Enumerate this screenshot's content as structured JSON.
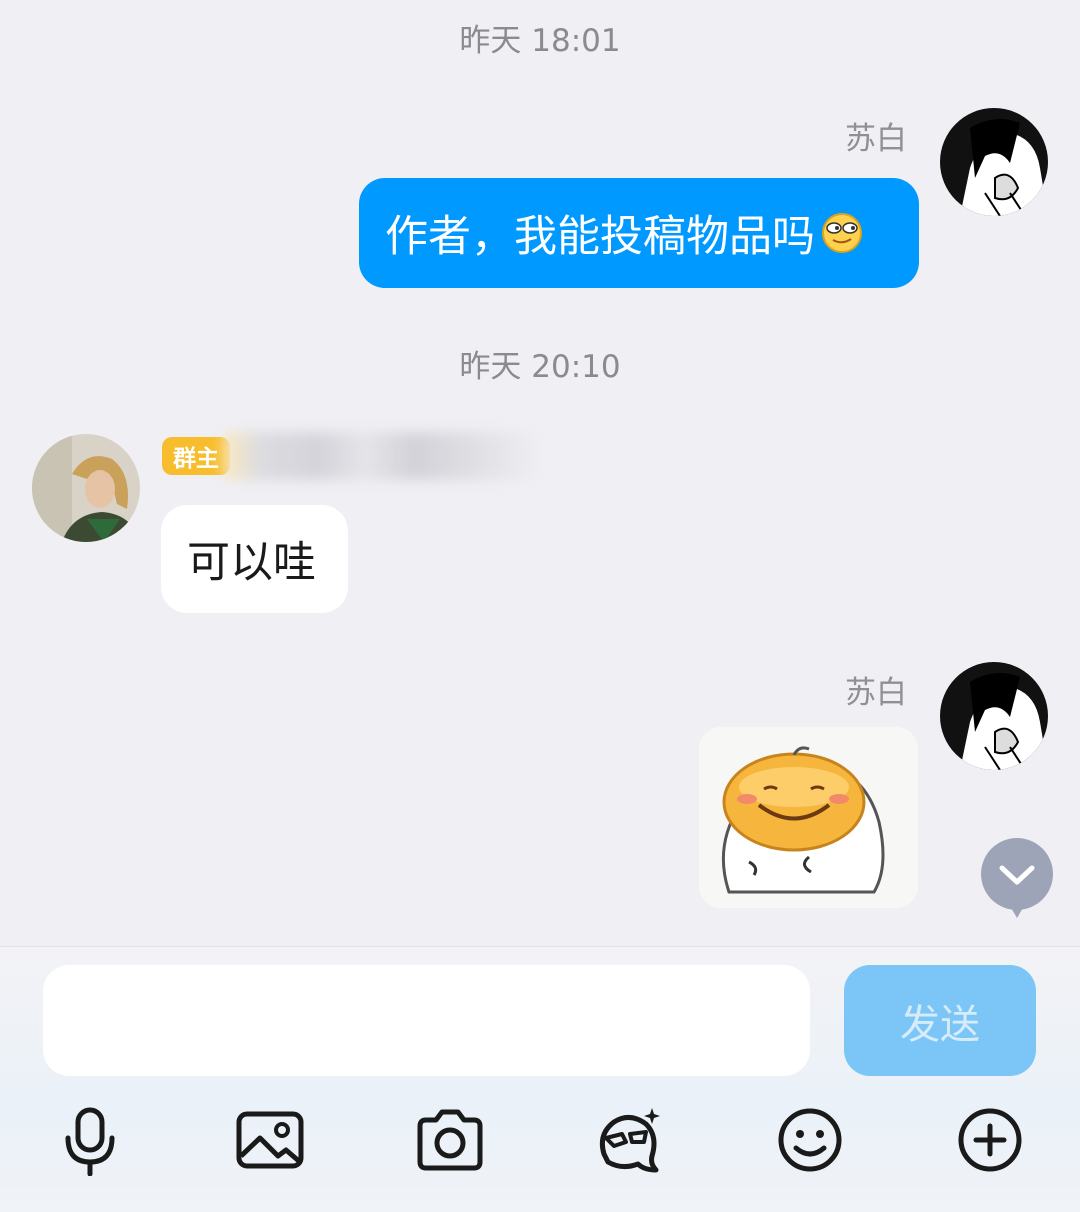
{
  "timestamps": [
    "昨天 18:01",
    "昨天 20:10"
  ],
  "messages": [
    {
      "sender": "苏白",
      "text": "作者，我能投稿物品吗"
    },
    {
      "badge": "群主",
      "text": "可以哇"
    },
    {
      "sender": "苏白",
      "sticker": "smiling-blob-sticker"
    }
  ],
  "composer": {
    "placeholder": "",
    "send_label": "发送"
  },
  "toolbar": [
    "microphone-icon",
    "image-icon",
    "camera-icon",
    "ai-avatar-icon",
    "emoji-icon",
    "plus-icon"
  ],
  "colors": {
    "my_bubble": "#0099ff",
    "send_disabled": "#7cc6f7",
    "owner_badge": "#f7bd2c",
    "background": "#efeff4"
  }
}
